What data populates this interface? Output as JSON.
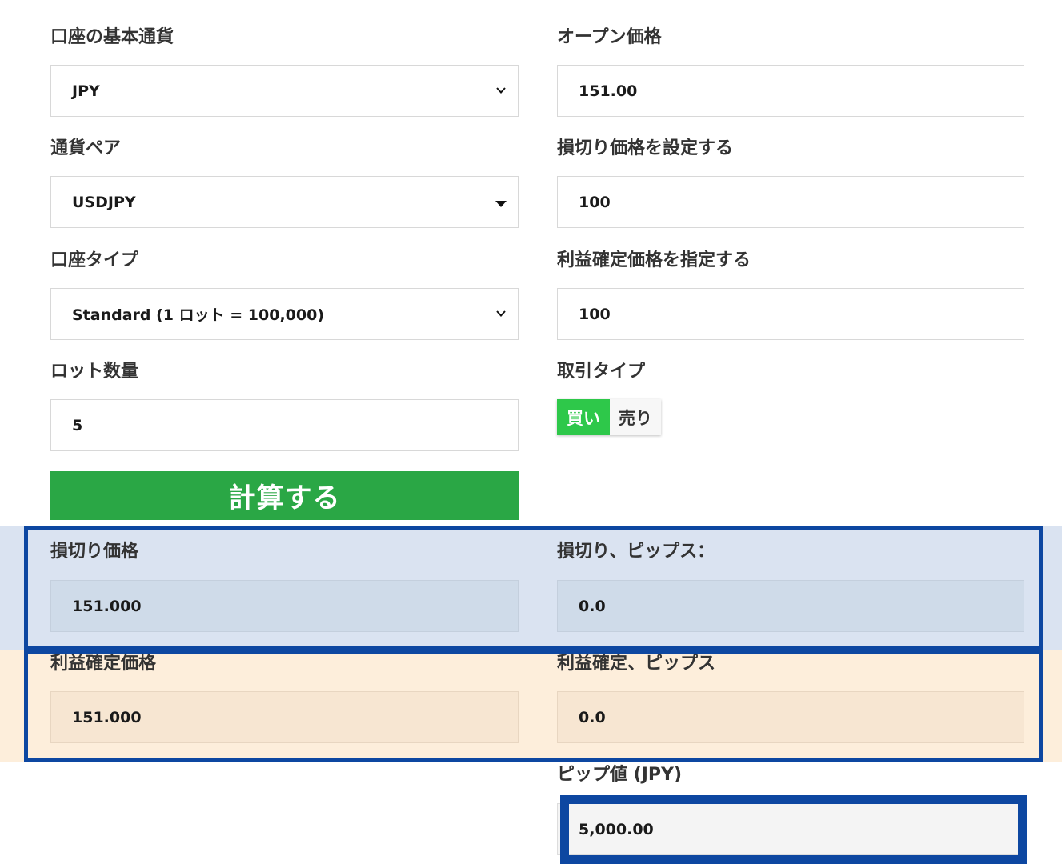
{
  "form": {
    "base_currency": {
      "label": "口座の基本通貨",
      "value": "JPY",
      "control": "chevron-down-icon"
    },
    "currency_pair": {
      "label": "通貨ペア",
      "value": "USDJPY",
      "control": "triangle-down-icon"
    },
    "account_type": {
      "label": "口座タイプ",
      "value": "Standard (1 ロット = 100,000)",
      "control": "chevron-down-icon"
    },
    "lot_size": {
      "label": "ロット数量",
      "value": "5"
    },
    "open_price": {
      "label": "オープン価格",
      "value": "151.00"
    },
    "stop_loss": {
      "label": "損切り価格を設定する",
      "value": "100"
    },
    "take_profit": {
      "label": "利益確定価格を指定する",
      "value": "100"
    },
    "trade_type": {
      "label": "取引タイプ",
      "buy": "買い",
      "sell": "売り",
      "selected": "buy"
    },
    "calculate_label": "計算する"
  },
  "results": {
    "stop_loss_price": {
      "label": "損切り価格",
      "value": "151.000"
    },
    "stop_loss_pips": {
      "label": "損切り、ピップス：",
      "value": "0.0"
    },
    "take_profit_price": {
      "label": "利益確定価格",
      "value": "151.000"
    },
    "take_profit_pips": {
      "label": "利益確定、ピップス",
      "value": "0.0"
    },
    "pip_value": {
      "label": "ピップ値 (JPY)",
      "value": "5,000.00"
    }
  },
  "colors": {
    "button_green": "#2aa745",
    "toggle_green": "#2ec84a",
    "highlight_blue": "#0d47a1",
    "band_blue": "#dae3f1",
    "band_orange": "#fdeedb"
  }
}
